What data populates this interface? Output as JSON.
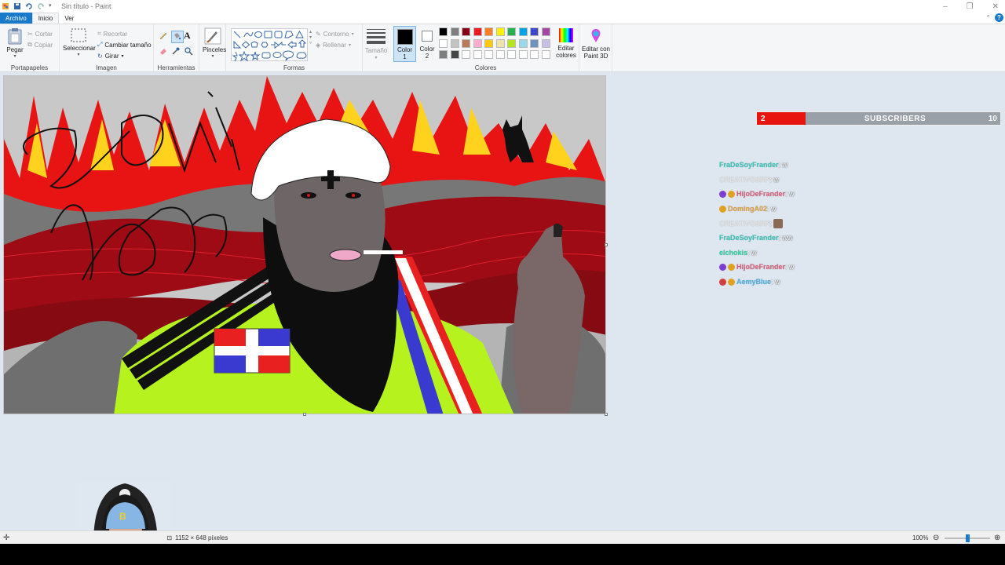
{
  "window": {
    "title": "Sin título - Paint",
    "minimize": "–",
    "restore": "❐",
    "close": "✕"
  },
  "tabs": {
    "file": "Archivo",
    "home": "Inicio",
    "view": "Ver"
  },
  "ribbon": {
    "clipboard": {
      "paste": "Pegar",
      "cut": "Cortar",
      "copy": "Copiar",
      "label": "Portapapeles"
    },
    "image": {
      "select": "Seleccionar",
      "crop": "Recortar",
      "resize": "Cambiar tamaño",
      "rotate": "Girar",
      "label": "Imagen"
    },
    "tools": {
      "label": "Herramientas"
    },
    "brushes": {
      "label": "Pinceles"
    },
    "shapes": {
      "outline": "Contorno",
      "fill": "Rellenar",
      "label": "Formas"
    },
    "size": {
      "label": "Tamaño"
    },
    "colors": {
      "color1_label": "Color",
      "color1_num": "1",
      "color2_label": "Color",
      "color2_num": "2",
      "edit_colors_1": "Editar",
      "edit_colors_2": "colores",
      "paint3d_1": "Editar con",
      "paint3d_2": "Paint 3D",
      "label": "Colores",
      "color1_value": "#000000",
      "color2_value": "#ffffff",
      "palette": [
        "#000000",
        "#7f7f7f",
        "#880015",
        "#ed1c24",
        "#ff7f27",
        "#fff200",
        "#22b14c",
        "#00a2e8",
        "#3f48cc",
        "#a349a4",
        "#ffffff",
        "#c3c3c3",
        "#b97a57",
        "#ffaec9",
        "#ffc90e",
        "#efe4b0",
        "#b5e61d",
        "#99d9ea",
        "#7092be",
        "#c8bfe7",
        "#7f7f7f",
        "#464646",
        "#ffffff",
        "#ffffff",
        "#ffffff",
        "#ffffff",
        "#ffffff",
        "#ffffff",
        "#ffffff",
        "#ffffff"
      ]
    }
  },
  "status": {
    "dimensions": "1152 × 648 píxeles",
    "zoom": "100%",
    "zoom_level": 1.0
  },
  "overlay": {
    "subscribers": {
      "current": "2",
      "label": "SUBSCRIBERS",
      "goal": "10",
      "progress": 0.2
    },
    "chat": [
      {
        "user": "FraDeSoyFrander",
        "msg": " : w",
        "color": "#3ac4b8",
        "badges": []
      },
      {
        "user": "CREATIVOSRP",
        "msg": " : w",
        "color": "#e3e3e3",
        "badges": []
      },
      {
        "user": "HijoDeFrander",
        "msg": " : w",
        "color": "#d9607a",
        "badges": [
          "#7b3fd1",
          "#e0a020"
        ]
      },
      {
        "user": "DomingA02",
        "msg": " : w",
        "color": "#e0a040",
        "badges": [
          "#e0a020"
        ]
      },
      {
        "user": "CREATIVOSRP",
        "msg": " : ",
        "color": "#e3e3e3",
        "badges": [],
        "emote": true
      },
      {
        "user": "FraDeSoyFrander",
        "msg": " : ww",
        "color": "#3ac4b8",
        "badges": []
      },
      {
        "user": "elchokis",
        "msg": " : w",
        "color": "#2ad0a0",
        "badges": []
      },
      {
        "user": "HijoDeFrander",
        "msg": " : w",
        "color": "#d9607a",
        "badges": [
          "#7b3fd1",
          "#e0a020"
        ]
      },
      {
        "user": "AemyBlue",
        "msg": " : w",
        "color": "#4cb0e0",
        "badges": [
          "#d04040",
          "#e0a020"
        ]
      }
    ]
  }
}
